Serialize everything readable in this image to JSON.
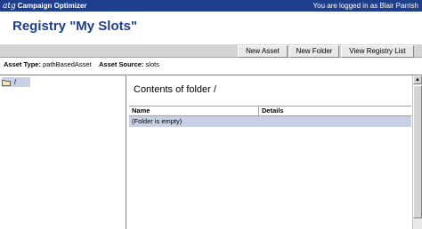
{
  "header": {
    "logo": "atg",
    "app_name": "Campaign Optimizer",
    "login_text": "You are logged in as Blair Parrish"
  },
  "page": {
    "title": "Registry \"My Slots\""
  },
  "toolbar": {
    "new_asset": "New Asset",
    "new_folder": "New Folder",
    "view_registry_list": "View Registry List"
  },
  "info": {
    "asset_type_label": "Asset Type:",
    "asset_type_value": "pathBasedAsset",
    "asset_source_label": "Asset Source:",
    "asset_source_value": "slots"
  },
  "tree": {
    "root_label": "/",
    "root_icon": "folder-icon"
  },
  "contents": {
    "title": "Contents of folder /",
    "columns": [
      "Name",
      "Details"
    ],
    "empty_text": "(Folder is empty)"
  },
  "colors": {
    "header_bg": "#1f3f8c",
    "title_text": "#1f3f8c",
    "selection_bg": "#c8d0e8",
    "toolbar_bg": "#d4d4d4"
  }
}
